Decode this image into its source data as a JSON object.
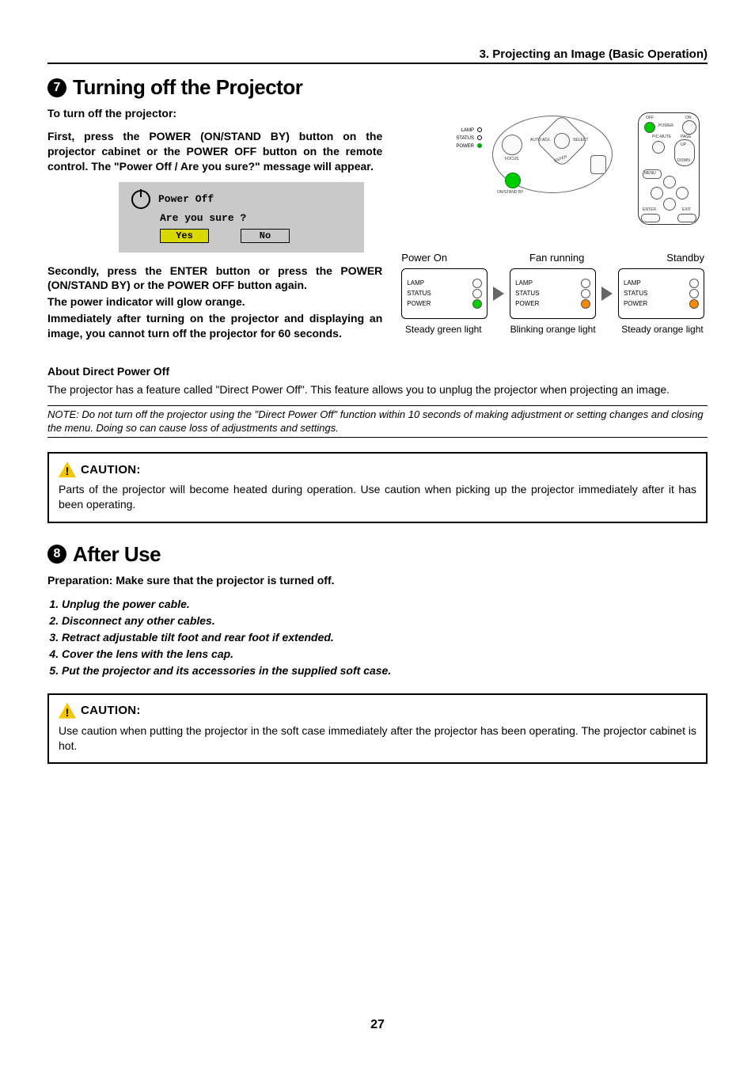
{
  "chapter_header": "3. Projecting an Image (Basic Operation)",
  "section7": {
    "num": "7",
    "title": "Turning off the Projector",
    "lead": "To turn off the projector:",
    "para1": "First, press the POWER (ON/STAND BY) button on the projector cabinet or the POWER OFF button on the remote control. The \"Power Off / Are you sure?\" message will appear.",
    "dialog": {
      "line1": "Power Off",
      "line2": "Are you sure ?",
      "yes": "Yes",
      "no": "No"
    },
    "para2_l1": "Secondly, press the ENTER button or press the POWER (ON/STAND BY) or the POWER OFF button again.",
    "para2_l2": "The power indicator will glow orange.",
    "para2_l3": "Immediately after turning on the projector and displaying an image, you cannot turn off the projector for 60 seconds.",
    "panel_legend": {
      "lamp": "LAMP",
      "status": "STATUS",
      "power": "POWER"
    },
    "panel_labels": {
      "focus": "FOCUS",
      "auto": "AUTO ADJ.",
      "select": "SELECT",
      "enter": "ENTER",
      "onstdby": "ON/STAND BY"
    },
    "remote_labels": {
      "off": "OFF",
      "on": "ON",
      "power": "POWER",
      "picmute": "PIC-MUTE",
      "page": "PAGE",
      "up": "UP",
      "down": "DOWN",
      "menu": "MENU",
      "enter": "ENTER",
      "exit": "EXIT"
    },
    "state_headers": {
      "a": "Power On",
      "b": "Fan running",
      "c": "Standby"
    },
    "state_labels": {
      "lamp": "LAMP",
      "status": "STATUS",
      "power": "POWER"
    },
    "state_captions": {
      "a": "Steady green light",
      "b": "Blinking orange light",
      "c": "Steady orange light"
    }
  },
  "direct_off": {
    "heading": "About Direct Power Off",
    "para": "The projector has a feature called \"Direct Power Off\". This feature allows you to unplug the projector when projecting an image.",
    "note": "NOTE: Do not turn off the projector using the \"Direct Power Off\" function within 10 seconds of making adjustment or setting changes and closing the menu. Doing so can cause loss of adjustments and settings."
  },
  "caution1": {
    "title": "CAUTION:",
    "text": "Parts of the projector will become heated during operation. Use caution when picking up the projector immediately after it has been operating."
  },
  "section8": {
    "num": "8",
    "title": "After Use",
    "lead": "Preparation: Make sure that the projector is turned off.",
    "steps": [
      "Unplug the power cable.",
      "Disconnect any other cables.",
      "Retract adjustable tilt foot and rear foot if extended.",
      "Cover the lens with the lens cap.",
      "Put the projector and its accessories in the supplied soft case."
    ]
  },
  "caution2": {
    "title": "CAUTION:",
    "text": "Use caution when putting the projector in the soft case immediately after the projector has been operating. The projector cabinet is hot."
  },
  "page_number": "27"
}
